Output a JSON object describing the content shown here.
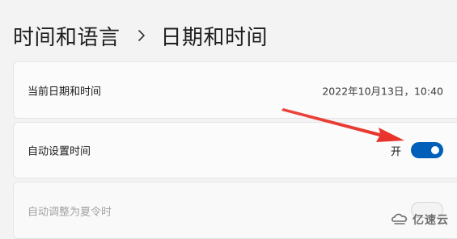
{
  "breadcrumb": {
    "parent": "时间和语言",
    "current": "日期和时间"
  },
  "settings": {
    "current_datetime": {
      "label": "当前日期和时间",
      "value": "2022年10月13日，10:40"
    },
    "auto_time": {
      "label": "自动设置时间",
      "state_text": "开",
      "enabled": true
    },
    "auto_dst": {
      "label": "自动调整为夏令时",
      "enabled": false,
      "disabled": true
    }
  },
  "colors": {
    "accent": "#005fb8",
    "annotation_arrow": "#e8312a"
  },
  "watermark": {
    "text": "亿速云"
  }
}
